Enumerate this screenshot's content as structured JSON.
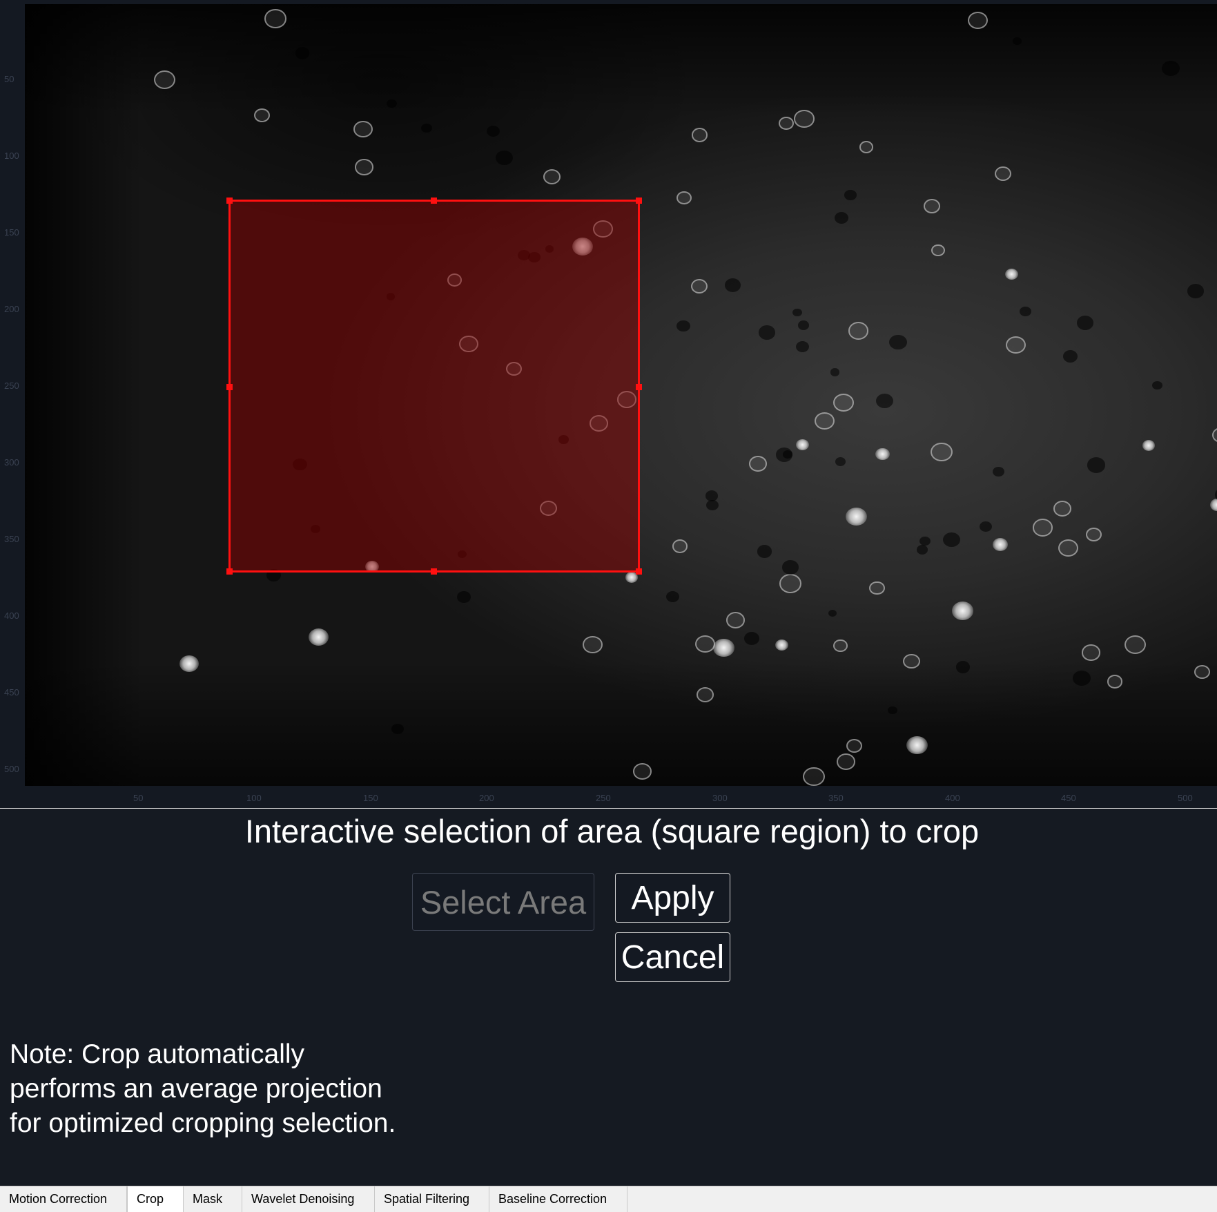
{
  "viewer": {
    "y_ticks": [
      "50",
      "100",
      "150",
      "200",
      "250",
      "300",
      "350",
      "400",
      "450",
      "500"
    ],
    "x_ticks": [
      "50",
      "100",
      "150",
      "200",
      "250",
      "300",
      "350",
      "400",
      "450",
      "500"
    ],
    "selection_color": "#ff1010",
    "image_description_colormap": "gray"
  },
  "panel": {
    "title": "Interactive selection of area (square region) to crop",
    "select_area_label": "Select Area",
    "apply_label": "Apply",
    "cancel_label": "Cancel",
    "note": "Note: Crop automatically performs an average projection for optimized cropping selection."
  },
  "tabs": [
    {
      "label": "Motion Correction",
      "active": false
    },
    {
      "label": "Crop",
      "active": true
    },
    {
      "label": "Mask",
      "active": false
    },
    {
      "label": "Wavelet Denoising",
      "active": false
    },
    {
      "label": "Spatial Filtering",
      "active": false
    },
    {
      "label": "Baseline Correction",
      "active": false
    }
  ]
}
